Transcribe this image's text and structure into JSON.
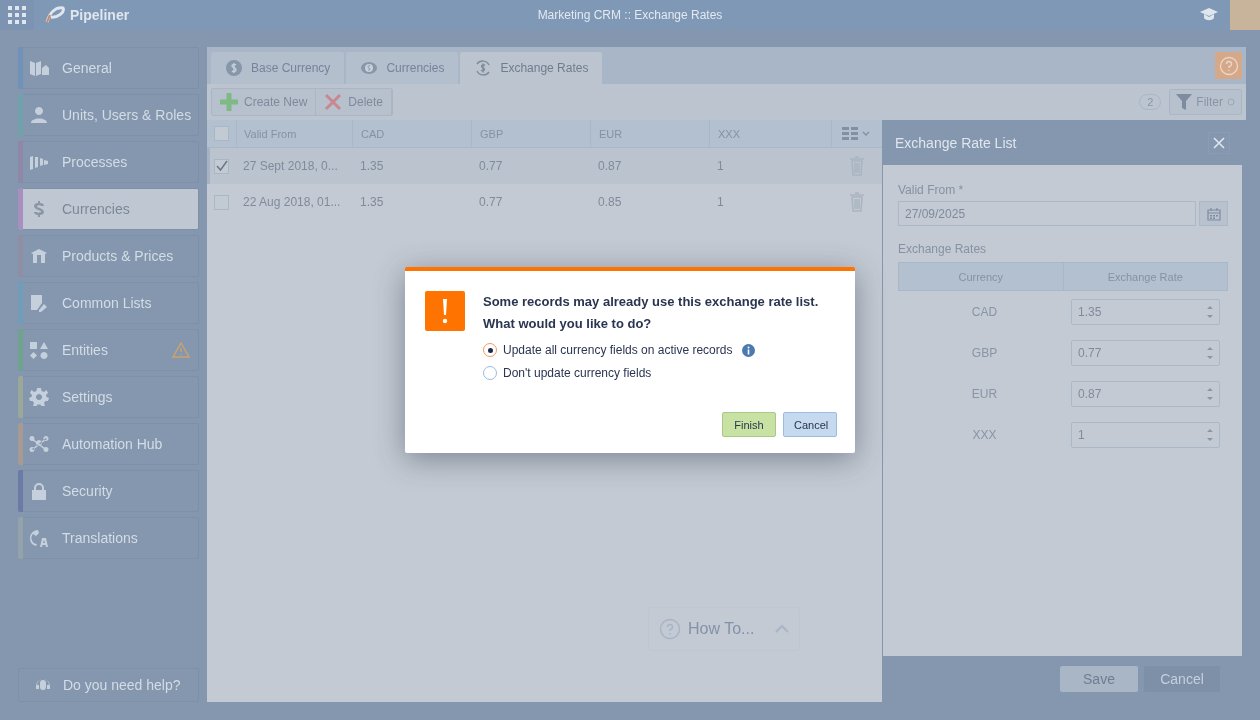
{
  "app": {
    "title": "Pipeliner",
    "window_title": "Marketing CRM :: Exchange Rates"
  },
  "sidebar": {
    "items": [
      {
        "label": "General",
        "selected": false,
        "warning": false,
        "color": "#6f93b8"
      },
      {
        "label": "Units, Users & Roles",
        "selected": false,
        "warning": false,
        "color": "#6fa3a9"
      },
      {
        "label": "Processes",
        "selected": false,
        "warning": false,
        "color": "#8f87a8"
      },
      {
        "label": "Currencies",
        "selected": true,
        "warning": false,
        "color": "#a98fc0"
      },
      {
        "label": "Products & Prices",
        "selected": false,
        "warning": false,
        "color": "#8f8ea4"
      },
      {
        "label": "Common Lists",
        "selected": false,
        "warning": false,
        "color": "#6f9dba"
      },
      {
        "label": "Entities",
        "selected": false,
        "warning": true,
        "color": "#6fa38d"
      },
      {
        "label": "Settings",
        "selected": false,
        "warning": false,
        "color": "#9aa89a"
      },
      {
        "label": "Automation Hub",
        "selected": false,
        "warning": false,
        "color": "#a79a92"
      },
      {
        "label": "Security",
        "selected": false,
        "warning": false,
        "color": "#6a7ca6"
      },
      {
        "label": "Translations",
        "selected": false,
        "warning": false,
        "color": "#94a3ab"
      }
    ],
    "help": "Do you need help?"
  },
  "tabs": [
    {
      "label": "Base Currency",
      "selected": false
    },
    {
      "label": "Currencies",
      "selected": false
    },
    {
      "label": "Exchange Rates",
      "selected": true
    }
  ],
  "toolbar": {
    "buttons": [
      "Create New",
      "Delete"
    ],
    "count": "2",
    "filter": "Filter"
  },
  "table": {
    "all_checked": false,
    "columns": [
      "Valid From",
      "CAD",
      "GBP",
      "EUR",
      "XXX"
    ],
    "rows": [
      {
        "checked": true,
        "selected": true,
        "cells": [
          "27 Sept 2018, 0...",
          "1.35",
          "0.77",
          "0.87",
          "1"
        ]
      },
      {
        "checked": false,
        "selected": false,
        "cells": [
          "22 Aug 2018, 01...",
          "1.35",
          "0.77",
          "0.85",
          "1"
        ]
      }
    ]
  },
  "how_to": "How To...",
  "panel": {
    "title": "Exchange Rate List",
    "valid_from_label": "Valid From *",
    "valid_from_value": "27/09/2025",
    "rates_label": "Exchange Rates",
    "columns": [
      "Currency",
      "Exchange Rate"
    ],
    "rates": [
      {
        "currency": "CAD",
        "value": "1.35"
      },
      {
        "currency": "GBP",
        "value": "0.77"
      },
      {
        "currency": "EUR",
        "value": "0.87"
      },
      {
        "currency": "XXX",
        "value": "1"
      }
    ],
    "buttons": [
      "Save",
      "Cancel"
    ]
  },
  "dialog": {
    "message": [
      "Some records may already use this exchange rate list.",
      "What would you like to do?"
    ],
    "options": [
      {
        "label": "Update all currency fields on active records",
        "selected": true,
        "info": true
      },
      {
        "label": "Don't update currency fields",
        "selected": false,
        "info": false
      }
    ],
    "buttons": [
      {
        "label": "Finish",
        "kind": "primary"
      },
      {
        "label": "Cancel",
        "kind": "secondary"
      }
    ]
  }
}
